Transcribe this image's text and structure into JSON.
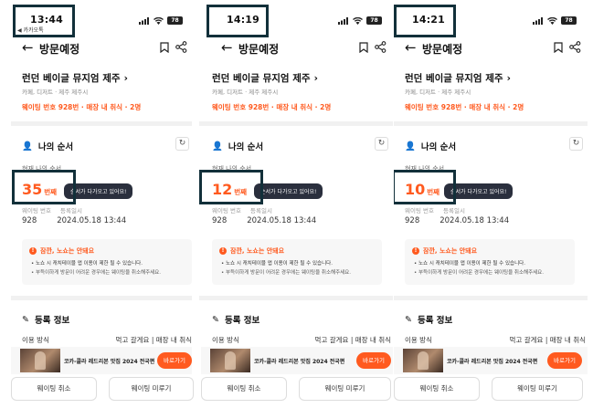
{
  "common": {
    "nav_title": "방문예정",
    "store_name": "런던 베이글 뮤지엄 제주",
    "store_category": "카페, 디저트 · 제주 제주시",
    "waiting_info": "웨이팅 번호 928번 · 매장 내 취식 · 2명",
    "my_order_title": "나의 순서",
    "current_order_label": "현재 나의 순서",
    "tooltip_text": "순서가 다가오고 있어요!",
    "waiting_number_label": "웨이팅 번호",
    "registered_at_label": "등록일시",
    "waiting_number": "928",
    "registered_at": "2024.05.18 13:44",
    "notice_title": "잠깐, 노쇼는 안돼요",
    "notice_line1": "노쇼 시 캐치테이블 앱 이용이 제한 될 수 있습니다.",
    "notice_line2": "부득이하게 방문이 어려운 경우에는 웨이팅을 취소해주세요.",
    "registration_title": "등록 정보",
    "usage_label": "이용 방식",
    "usage_value": "먹고 갈게요 | 매장 내 취식",
    "promo_text": "코카-콜라 레드리본 맛집 2024 전국편",
    "promo_button": "바로가기",
    "cancel_button": "웨이팅 취소",
    "postpone_button": "웨이팅 미루기",
    "order_unit": "번째",
    "battery_level": "78"
  },
  "panels": [
    {
      "time": "14:19",
      "order_number": "12"
    },
    {
      "time": "14:21",
      "order_number": "10"
    }
  ],
  "first_panel": {
    "time": "13:44",
    "back_app_label": "◀ 카카오톡",
    "order_number": "35"
  },
  "colors": {
    "accent": "#ff5a1f",
    "highlight_box": "#12303a"
  }
}
